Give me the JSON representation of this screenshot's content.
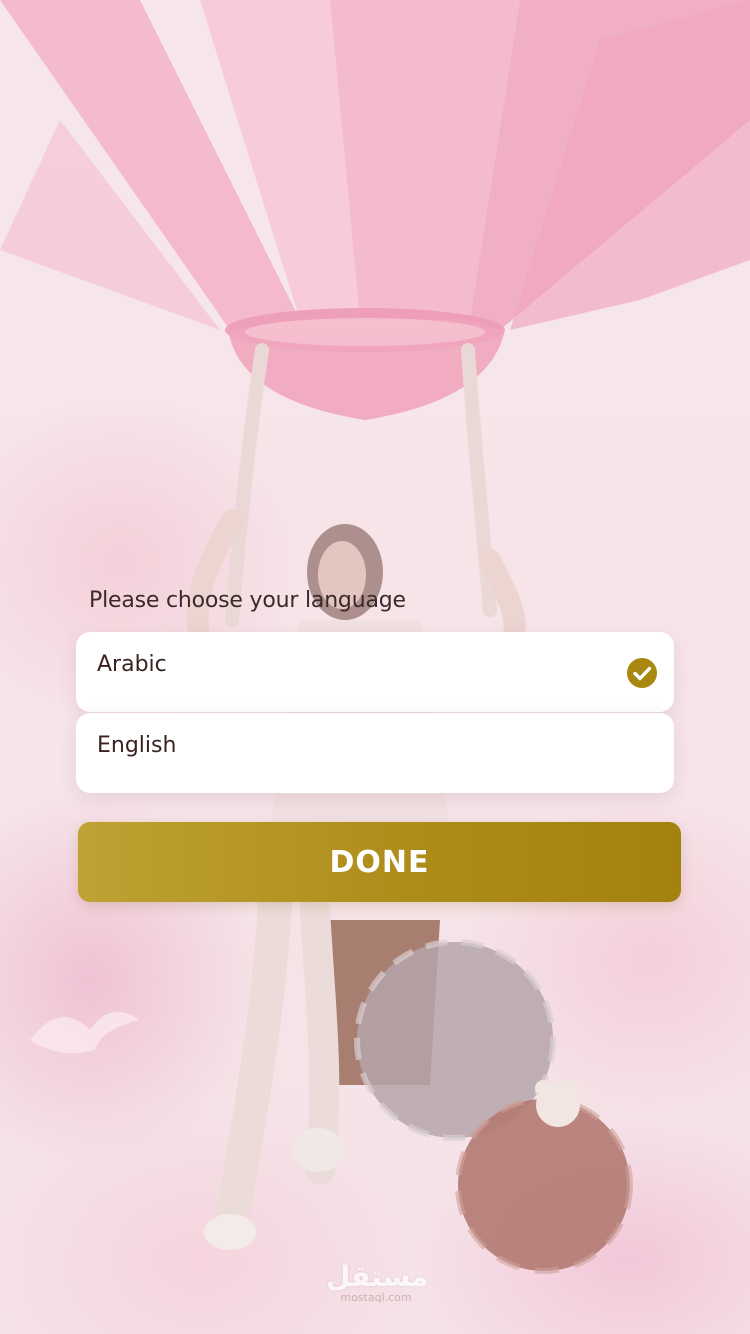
{
  "language_screen": {
    "prompt": "Please choose your language",
    "options": [
      {
        "label": "Arabic",
        "selected": true
      },
      {
        "label": "English",
        "selected": false
      }
    ],
    "done_label": "DONE"
  },
  "watermark": {
    "logo": "مستقل",
    "site": "mostaql.com"
  },
  "colors": {
    "accent": "#b0901d",
    "background": "#f6e4e8",
    "balloon_pink": "#f09ab5",
    "text": "#3a2222"
  },
  "icons": {
    "selected_indicator": "check-circle-icon"
  }
}
